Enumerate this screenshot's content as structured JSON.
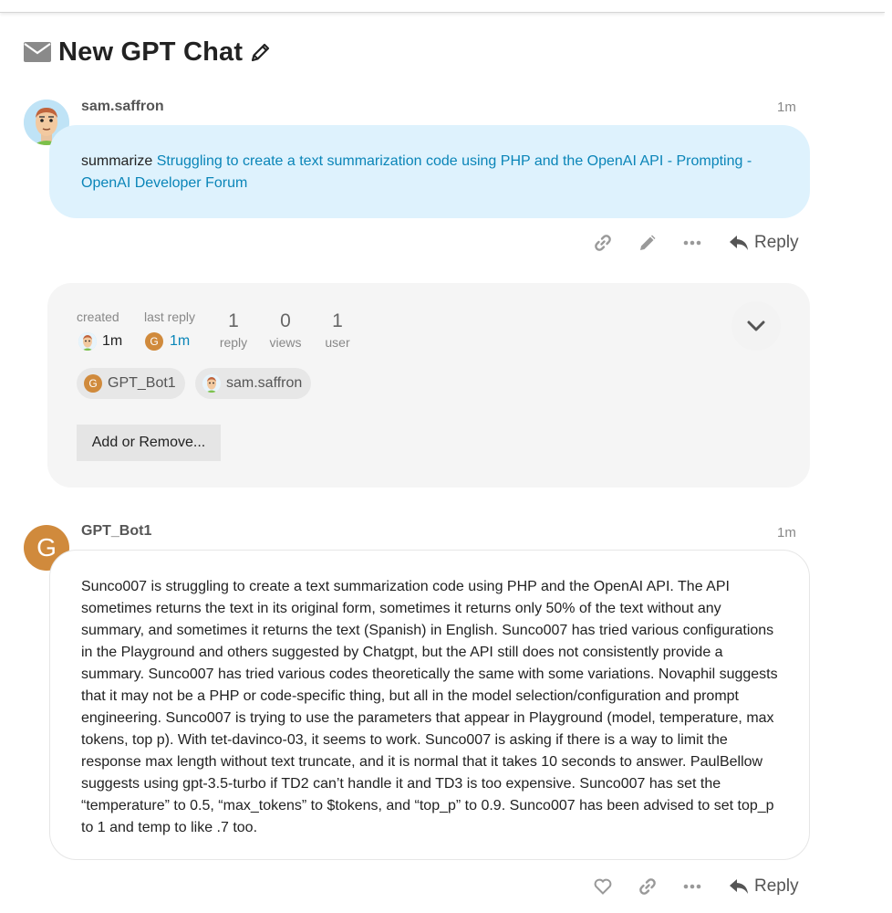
{
  "topic": {
    "title": "New GPT Chat",
    "icon": "envelope-icon",
    "edit_icon": "pencil-icon"
  },
  "posts": [
    {
      "author": "sam.saffron",
      "age": "1m",
      "text_prefix": "summarize ",
      "link_text": "Struggling to create a text summarization code using PHP and the OpenAI API - Prompting - OpenAI Developer Forum",
      "actions": [
        "link-icon",
        "pencil-icon",
        "more-icon"
      ],
      "reply_label": "Reply"
    },
    {
      "author": "GPT_Bot1",
      "avatar_letter": "G",
      "avatar_color": "#d08a3c",
      "age": "1m",
      "body": "Sunco007 is struggling to create a text summarization code using PHP and the OpenAI API. The API sometimes returns the text in its original form, sometimes it returns only 50% of the text without any summary, and sometimes it returns the text (Spanish) in English. Sunco007 has tried various configurations in the Playground and others suggested by Chatgpt, but the API still does not consistently provide a summary. Sunco007 has tried various codes theoretically the same with some variations. Novaphil suggests that it may not be a PHP or code-specific thing, but all in the model selection/configuration and prompt engineering. Sunco007 is trying to use the parameters that appear in Playground (model, temperature, max tokens, top p). With tet-davinco-03, it seems to work. Sunco007 is asking if there is a way to limit the response max length without text truncate, and it is normal that it takes 10 seconds to answer. PaulBellow suggests using gpt-3.5-turbo if TD2 can’t handle it and TD3 is too expensive. Sunco007 has set the “temperature” to 0.5, “max_tokens” to $tokens, and “top_p” to 0.9. Sunco007 has been advised to set top_p to 1 and temp to like .7 too.",
      "actions": [
        "heart-icon",
        "link-icon",
        "more-icon"
      ],
      "reply_label": "Reply"
    }
  ],
  "topic_map": {
    "created_label": "created",
    "created_value": "1m",
    "last_reply_label": "last reply",
    "last_reply_value": "1m",
    "last_reply_avatar_letter": "G",
    "stats": [
      {
        "value": "1",
        "label": "reply"
      },
      {
        "value": "0",
        "label": "views"
      },
      {
        "value": "1",
        "label": "user"
      }
    ],
    "participants": [
      {
        "name": "GPT_Bot1",
        "letter": "G"
      },
      {
        "name": "sam.saffron"
      }
    ],
    "add_remove_label": "Add or Remove...",
    "expand_icon": "chevron-down-icon"
  },
  "colors": {
    "link": "#0a85b8",
    "bubble_user": "#def2fd",
    "topic_map_bg": "#f5f5f5",
    "bot_avatar": "#d08a3c"
  }
}
